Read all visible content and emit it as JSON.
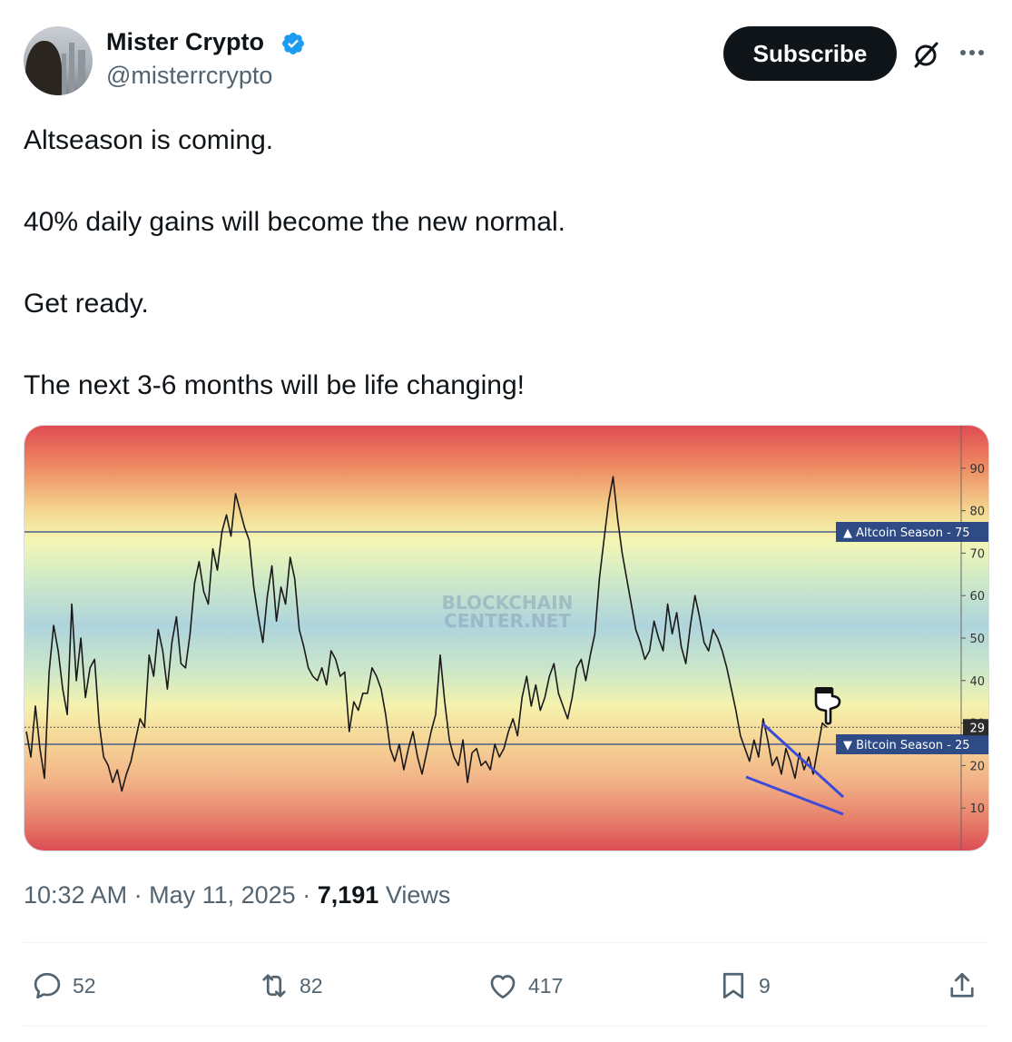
{
  "author": {
    "name": "Mister Crypto",
    "handle": "@misterrcrypto",
    "verified": true
  },
  "header": {
    "subscribe_label": "Subscribe"
  },
  "tweet": {
    "lines": [
      "Altseason is coming.",
      "",
      "40% daily gains will become the new normal.",
      "",
      "Get ready.",
      "",
      "The next 3-6 months will be life changing!"
    ],
    "time": "10:32 AM",
    "date": "May 11, 2025",
    "views_count": "7,191",
    "views_label": "Views"
  },
  "stats": {
    "replies": "52",
    "reposts": "82",
    "likes": "417",
    "bookmarks": "9"
  },
  "chart_data": {
    "type": "line",
    "watermark_line1": "BLOCKCHAIN",
    "watermark_line2": "CENTER.NET",
    "ylim": [
      0,
      100
    ],
    "yticks": [
      10,
      20,
      30,
      40,
      50,
      60,
      70,
      80,
      90
    ],
    "current_value": 29,
    "annotations": [
      {
        "label": "▲ Altcoin Season",
        "value": 75
      },
      {
        "label": "▼ Bitcoin Season",
        "value": 25
      }
    ],
    "series": [
      {
        "values": [
          28,
          22,
          34,
          24,
          17,
          42,
          53,
          47,
          38,
          32,
          58,
          40,
          50,
          36,
          43,
          45,
          30,
          22,
          20,
          16,
          19,
          14,
          18,
          21,
          26,
          31,
          29,
          46,
          41,
          52,
          47,
          38,
          49,
          55,
          44,
          43,
          51,
          63,
          68,
          61,
          58,
          71,
          66,
          75,
          79,
          74,
          84,
          80,
          76,
          73,
          62,
          55,
          49,
          60,
          67,
          54,
          62,
          58,
          69,
          64,
          52,
          48,
          43,
          41,
          40,
          43,
          39,
          47,
          45,
          41,
          42,
          28,
          35,
          33,
          37,
          37,
          43,
          41,
          38,
          32,
          24,
          21,
          25,
          19,
          24,
          28,
          22,
          18,
          23,
          28,
          32,
          46,
          35,
          26,
          22,
          20,
          26,
          16,
          23,
          24,
          20,
          21,
          19,
          25,
          22,
          24,
          28,
          31,
          27,
          36,
          41,
          34,
          39,
          33,
          36,
          41,
          44,
          37,
          34,
          31,
          36,
          43,
          45,
          40,
          46,
          51,
          64,
          73,
          82,
          88,
          78,
          70,
          64,
          58,
          52,
          49,
          45,
          47,
          54,
          50,
          47,
          58,
          51,
          56,
          48,
          44,
          53,
          60,
          55,
          49,
          47,
          52,
          50,
          47,
          43,
          38,
          33,
          27,
          24,
          21,
          26,
          22,
          31,
          26,
          20,
          22,
          18,
          24,
          21,
          17,
          23,
          19,
          22,
          18,
          24,
          30,
          29
        ]
      }
    ]
  },
  "colors": {
    "text_primary": "#0f1419",
    "text_secondary": "#536471",
    "verified_blue": "#1d9bf0",
    "chart_line": "#1a1a1a",
    "season_line": "#4a5f8a",
    "label_box": "#2e4b85",
    "wedge": "#3b4bd8"
  },
  "icons": [
    "verified-badge-icon",
    "grok-icon",
    "more-icon",
    "reply-icon",
    "repost-icon",
    "like-icon",
    "bookmark-icon",
    "share-icon",
    "pointing-hand-icon"
  ]
}
